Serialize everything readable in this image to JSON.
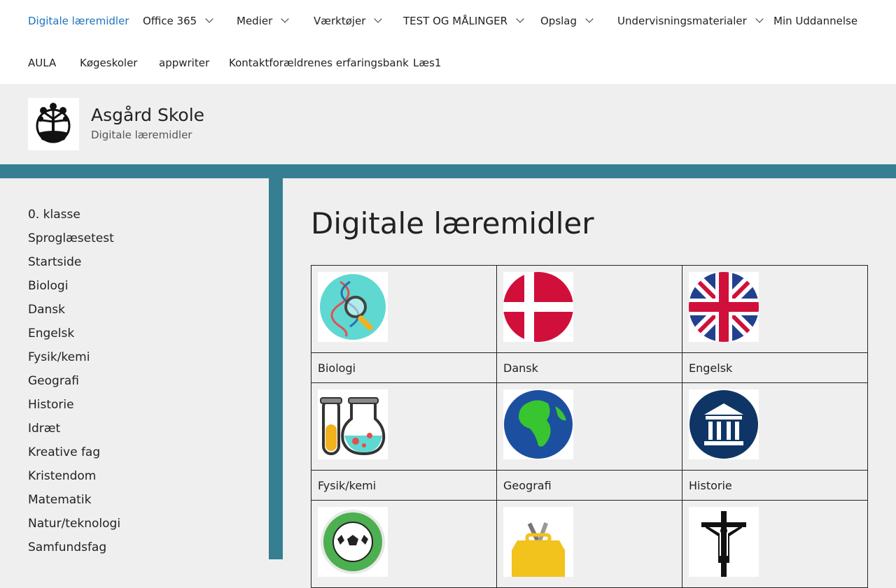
{
  "nav": {
    "row1": [
      {
        "label": "Digitale læremidler",
        "has_menu": false,
        "active": true
      },
      {
        "label": "Office 365",
        "has_menu": true
      },
      {
        "label": "Medier",
        "has_menu": true
      },
      {
        "label": "Værktøjer",
        "has_menu": true
      },
      {
        "label": "TEST OG MÅLINGER",
        "has_menu": true
      },
      {
        "label": "Opslag",
        "has_menu": true
      },
      {
        "label": "Undervisningsmaterialer",
        "has_menu": true
      },
      {
        "label": "Min Uddannelse",
        "has_menu": false
      }
    ],
    "row2": [
      {
        "label": "AULA"
      },
      {
        "label": "Køgeskoler"
      },
      {
        "label": "appwriter"
      },
      {
        "label": "Kontaktforældrenes erfaringsbank"
      },
      {
        "label": "Læs1"
      }
    ]
  },
  "site": {
    "title": "Asgård Skole",
    "description": "Digitale læremidler"
  },
  "sidebar": {
    "items": [
      "0. klasse",
      "Sproglæsetest",
      "Startside",
      "Biologi",
      "Dansk",
      "Engelsk",
      "Fysik/kemi",
      "Geografi",
      "Historie",
      "Idræt",
      "Kreative fag",
      "Kristendom",
      "Matematik",
      "Natur/teknologi",
      "Samfundsfag"
    ]
  },
  "page": {
    "title": "Digitale læremidler"
  },
  "grid": {
    "rows": [
      [
        "Biologi",
        "Dansk",
        "Engelsk"
      ],
      [
        "Fysik/kemi",
        "Geografi",
        "Historie"
      ],
      [
        "",
        "",
        ""
      ]
    ],
    "icons": [
      [
        "dna-magnifier-icon",
        "danish-flag-icon",
        "uk-flag-icon"
      ],
      [
        "test-tubes-icon",
        "globe-icon",
        "museum-icon"
      ],
      [
        "football-icon",
        "toolbox-icon",
        "crucifix-icon"
      ]
    ]
  },
  "colors": {
    "accent": "#1e73be",
    "bar": "#367f93",
    "background": "#efefef"
  }
}
